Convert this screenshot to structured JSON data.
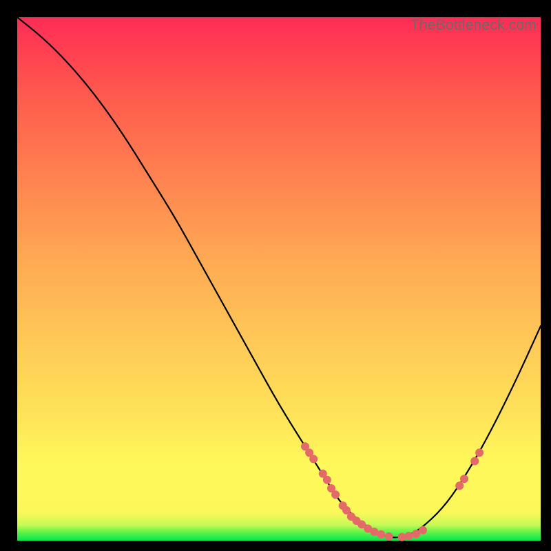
{
  "watermark": "TheBottleneck.com",
  "chart_data": {
    "type": "line",
    "title": "",
    "xlabel": "",
    "ylabel": "",
    "xlim": [
      0,
      100
    ],
    "ylim": [
      0,
      100
    ],
    "series": [
      {
        "name": "bottleneck-curve",
        "x": [
          0,
          5,
          10,
          15,
          20,
          25,
          30,
          35,
          40,
          45,
          50,
          55,
          60,
          62,
          65,
          68,
          70,
          72,
          75,
          78,
          82,
          86,
          90,
          95,
          100
        ],
        "values": [
          100,
          96,
          91,
          85,
          78,
          70,
          62,
          53,
          44,
          35,
          26,
          18,
          10,
          7,
          4,
          2,
          1,
          0.5,
          1,
          3,
          7,
          13,
          20,
          30,
          41
        ]
      }
    ],
    "marker_clusters": [
      {
        "name": "left-branch-markers",
        "x": [
          55,
          55.8,
          56.6,
          58.4,
          59.2,
          60,
          60.8,
          62.2,
          62.9
        ],
        "y": [
          18,
          16.8,
          15.6,
          12.8,
          11.6,
          10,
          8.8,
          6.7,
          5.8
        ]
      },
      {
        "name": "valley-floor-markers",
        "x": [
          63.8,
          64.8,
          65.8,
          67,
          68.2,
          69.5,
          71,
          73.5,
          74.8,
          76.2,
          77.5
        ],
        "y": [
          4.6,
          3.8,
          3.1,
          2.3,
          1.7,
          1.2,
          0.8,
          0.7,
          0.9,
          1.3,
          2.0
        ]
      },
      {
        "name": "right-branch-markers",
        "x": [
          84.5,
          85.4,
          87.4,
          88.3
        ],
        "y": [
          10.5,
          11.8,
          15.2,
          16.8
        ]
      }
    ],
    "colors": {
      "curve": "#000000",
      "marker": "#e46a6a",
      "gradient_top": "#ff2c55",
      "gradient_mid": "#fff85a",
      "gradient_bottom": "#00e84a"
    }
  }
}
